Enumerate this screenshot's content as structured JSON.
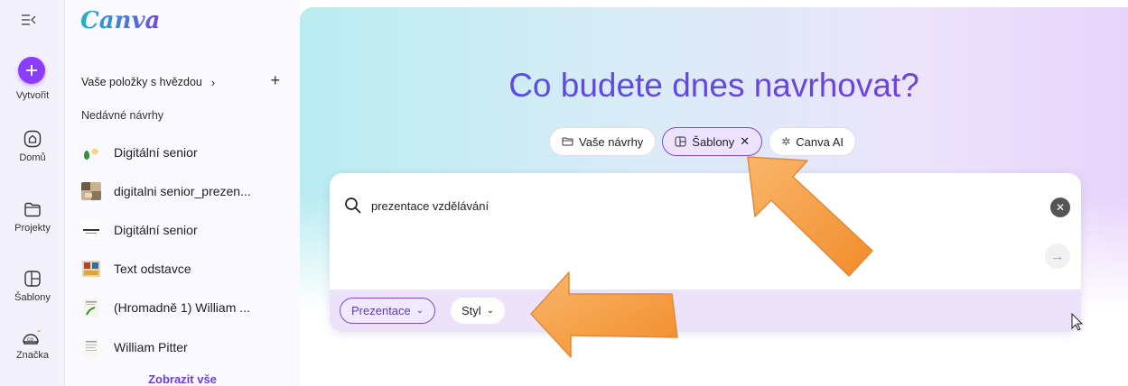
{
  "rail": {
    "create_label": "Vytvořit",
    "items": [
      {
        "label": "Domů",
        "icon": "home-icon"
      },
      {
        "label": "Projekty",
        "icon": "folder-icon"
      },
      {
        "label": "Šablony",
        "icon": "templates-icon"
      },
      {
        "label": "Značka",
        "icon": "brand-icon"
      }
    ]
  },
  "panel": {
    "logo": "Canva",
    "starred": "Vaše položky s hvězdou",
    "recent_title": "Nedávné návrhy",
    "recent": [
      {
        "name": "Digitální senior"
      },
      {
        "name": "digitalni senior_prezen..."
      },
      {
        "name": "Digitální senior"
      },
      {
        "name": "Text odstavce"
      },
      {
        "name": "(Hromadně 1) William ..."
      },
      {
        "name": "William Pitter"
      }
    ],
    "show_all": "Zobrazit vše"
  },
  "main": {
    "title": "Co budete dnes navrhovat?",
    "chips": [
      {
        "label": "Vaše návrhy",
        "icon": "folder-icon",
        "active": false
      },
      {
        "label": "Šablony",
        "icon": "templates-icon",
        "active": true
      },
      {
        "label": "Canva AI",
        "icon": "sparkle-icon",
        "active": false
      }
    ],
    "search": {
      "value": "prezentace vzdělávání"
    },
    "filters": {
      "type": "Prezentace",
      "style": "Styl"
    }
  },
  "colors": {
    "accent": "#8b3dff",
    "annotation_arrow": "#f7a04b"
  }
}
